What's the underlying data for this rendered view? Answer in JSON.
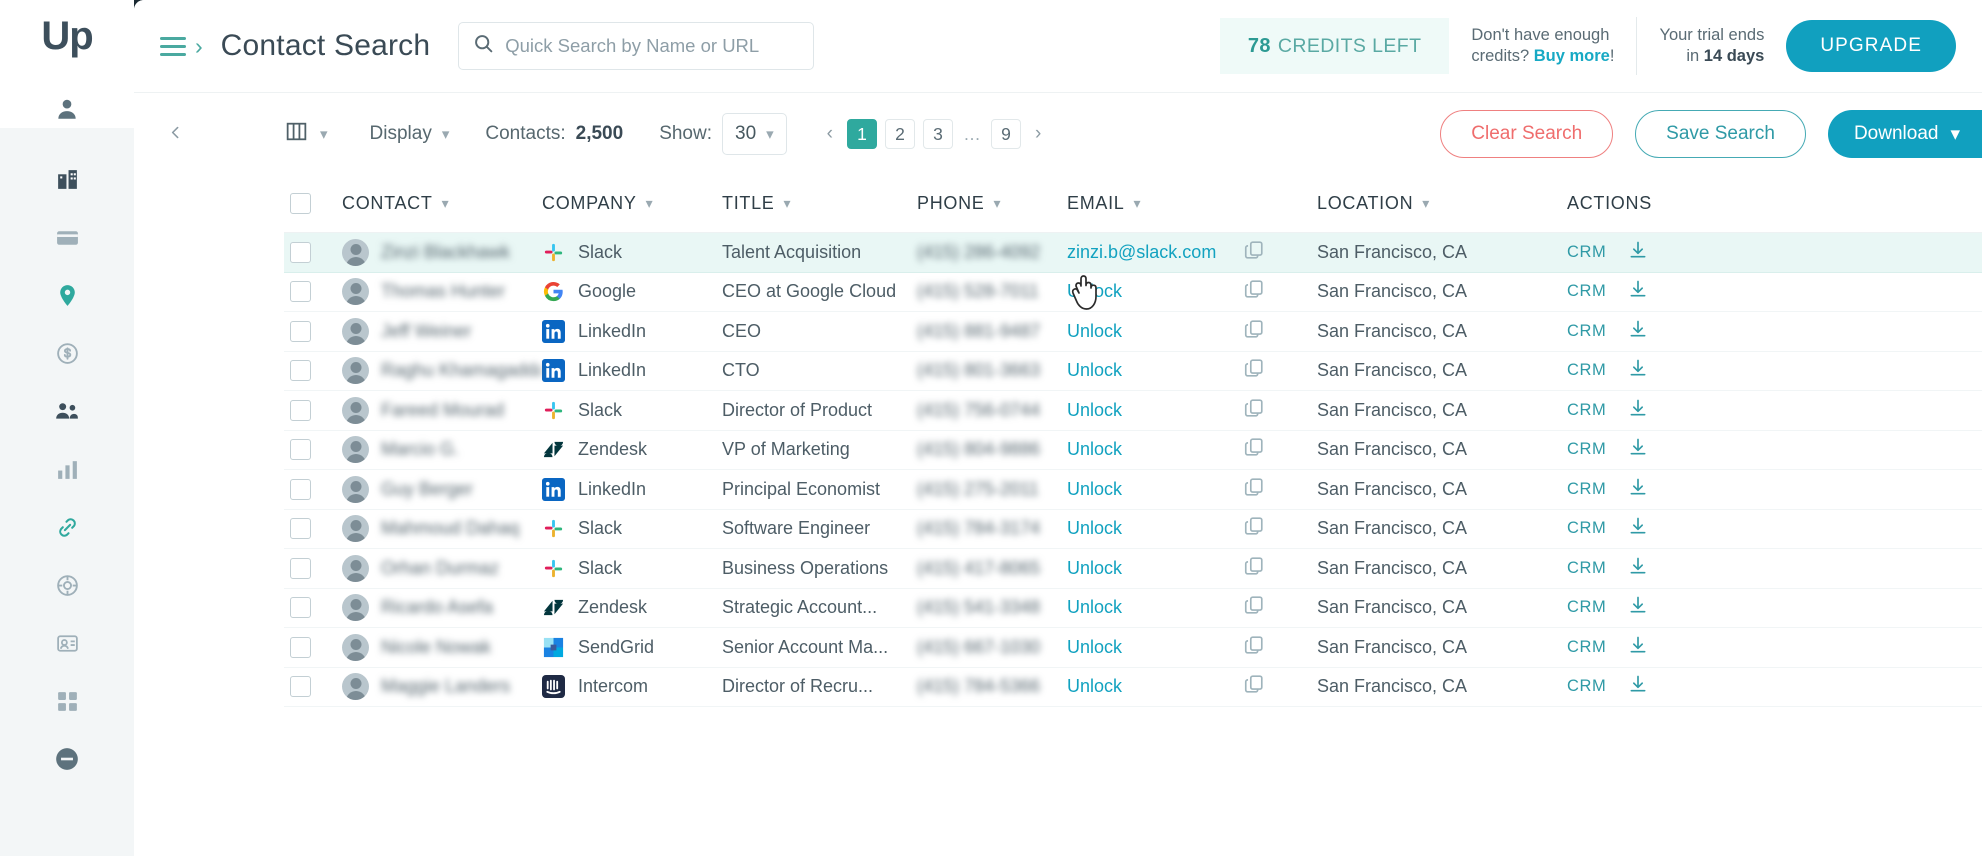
{
  "brand": {
    "logo_text": "Up",
    "accent": "#11a0bf",
    "teal": "#2fa99e",
    "red": "#ef6d6d"
  },
  "header": {
    "menu_icon": "hamburger-icon",
    "breadcrumb_chevron": "chevron-right-icon",
    "title": "Contact Search",
    "search": {
      "placeholder": "Quick Search by Name or URL",
      "value": "",
      "icon": "search-icon"
    },
    "credits": {
      "count": "78",
      "label": "CREDITS LEFT"
    },
    "buy_prompt": {
      "line1": "Don't have enough",
      "line2_prefix": "credits? ",
      "link": "Buy more",
      "suffix": "!"
    },
    "trial": {
      "line1": "Your trial ends",
      "line2_prefix": "in ",
      "days": "14 days"
    },
    "upgrade_label": "UPGRADE"
  },
  "toolbar": {
    "collapse_icon": "chevron-left-icon",
    "columns_icon": "columns-icon",
    "display_label": "Display",
    "contacts_label": "Contacts:",
    "contacts_count": "2,500",
    "show_label": "Show:",
    "show_value": "30",
    "pagination": {
      "prev": "‹",
      "next": "›",
      "pages": [
        "1",
        "2",
        "3",
        "…",
        "9"
      ],
      "active": "1"
    },
    "clear_label": "Clear Search",
    "save_label": "Save Search",
    "download_label": "Download"
  },
  "table": {
    "columns": [
      "CONTACT",
      "COMPANY",
      "TITLE",
      "PHONE",
      "EMAIL",
      "LOCATION",
      "ACTIONS"
    ],
    "unlock_label": "Unlock",
    "crm_label": "CRM",
    "rows": [
      {
        "company": "Slack",
        "logo": "slack-icon",
        "title": "Talent Acquisition",
        "email": "zinzi.b@slack.com",
        "locked": false,
        "location": "San Francisco, CA",
        "highlight": true
      },
      {
        "company": "Google",
        "logo": "google-icon",
        "title": "CEO at Google Cloud",
        "email": "Unlock",
        "locked": true,
        "location": "San Francisco, CA",
        "highlight": false
      },
      {
        "company": "LinkedIn",
        "logo": "linkedin-icon",
        "title": "CEO",
        "email": "Unlock",
        "locked": true,
        "location": "San Francisco, CA",
        "highlight": false
      },
      {
        "company": "LinkedIn",
        "logo": "linkedin-icon",
        "title": "CTO",
        "email": "Unlock",
        "locked": true,
        "location": "San Francisco, CA",
        "highlight": false
      },
      {
        "company": "Slack",
        "logo": "slack-icon",
        "title": "Director of Product",
        "email": "Unlock",
        "locked": true,
        "location": "San Francisco, CA",
        "highlight": false
      },
      {
        "company": "Zendesk",
        "logo": "zendesk-icon",
        "title": "VP of Marketing",
        "email": "Unlock",
        "locked": true,
        "location": "San Francisco, CA",
        "highlight": false
      },
      {
        "company": "LinkedIn",
        "logo": "linkedin-icon",
        "title": "Principal Economist",
        "email": "Unlock",
        "locked": true,
        "location": "San Francisco, CA",
        "highlight": false
      },
      {
        "company": "Slack",
        "logo": "slack-icon",
        "title": "Software Engineer",
        "email": "Unlock",
        "locked": true,
        "location": "San Francisco, CA",
        "highlight": false
      },
      {
        "company": "Slack",
        "logo": "slack-icon",
        "title": "Business Operations",
        "email": "Unlock",
        "locked": true,
        "location": "San Francisco, CA",
        "highlight": false
      },
      {
        "company": "Zendesk",
        "logo": "zendesk-icon",
        "title": "Strategic Account...",
        "email": "Unlock",
        "locked": true,
        "location": "San Francisco, CA",
        "highlight": false
      },
      {
        "company": "SendGrid",
        "logo": "sendgrid-icon",
        "title": "Senior Account Ma...",
        "email": "Unlock",
        "locked": true,
        "location": "San Francisco, CA",
        "highlight": false
      },
      {
        "company": "Intercom",
        "logo": "intercom-icon",
        "title": "Director of Recru...",
        "email": "Unlock",
        "locked": true,
        "location": "San Francisco, CA",
        "highlight": false
      }
    ],
    "masked_names": [
      "Zinzi Blackhawk",
      "Thomas Hunter",
      "Jeff Weiner",
      "Raghu Khamagadda",
      "Fareed Mourad",
      "Marcio G.",
      "Guy Berger",
      "Mahmoud Dahaq",
      "Orhan Durmaz",
      "Ricardo Asefa",
      "Nicole Nowak",
      "Maggie Landers"
    ],
    "masked_phones": [
      "(415) 286-4092",
      "(415) 528-7011",
      "(415) 881-9487",
      "(415) 801-3663",
      "(415) 756-0744",
      "(415) 804-9886",
      "(415) 275-2011",
      "(415) 784-3174",
      "(415) 417-8065",
      "(415) 541-3348",
      "(415) 667-1030",
      "(415) 784-5366"
    ]
  },
  "sidebar": {
    "items": [
      {
        "icon": "user-icon"
      },
      {
        "icon": "building-icon"
      },
      {
        "icon": "list-icon"
      },
      {
        "icon": "grid-icon"
      }
    ],
    "sub_items": [
      {
        "icon": "company-icon",
        "active": true
      },
      {
        "icon": "card-icon"
      },
      {
        "icon": "location-pin-icon"
      },
      {
        "icon": "dollar-circle-icon"
      },
      {
        "icon": "people-icon",
        "active": true
      },
      {
        "icon": "chart-icon"
      },
      {
        "icon": "link-icon"
      },
      {
        "icon": "target-icon"
      },
      {
        "icon": "badge-icon"
      },
      {
        "icon": "apps-icon"
      },
      {
        "icon": "minus-circle-icon"
      }
    ]
  }
}
